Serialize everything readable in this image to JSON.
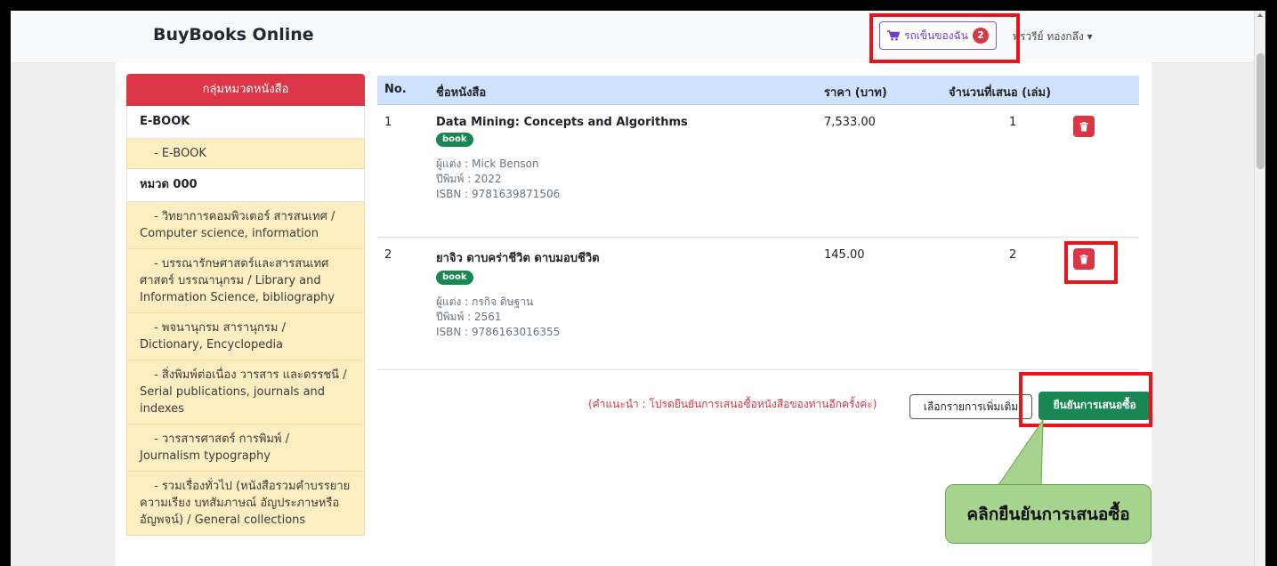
{
  "navbar": {
    "brand": "BuyBooks Online",
    "cart_label": "รถเข็นของฉัน",
    "cart_count": "2",
    "user_name": "พรวรีย์ ทองกลึง"
  },
  "sidebar": {
    "header": "กลุ่มหมวดหนังสือ",
    "group_ebook": "E-BOOK",
    "item_ebook": "- E-BOOK",
    "group_000": "หมวด 000",
    "items": [
      "- วิทยาการคอมพิวเตอร์ สารสนเทศ / Computer science, information",
      "- บรรณารักษศาสตร์และสารสนเทศศาสตร์ บรรณานุกรม / Library and Information Science, bibliography",
      "- พจนานุกรม สารานุกรม / Dictionary, Encyclopedia",
      "- สิ่งพิมพ์ต่อเนื่อง วารสาร และดรรชนี / Serial publications, journals and indexes",
      "- วารสารศาสตร์ การพิมพ์ / Journalism typography",
      "- รวมเรื่องทั่วไป (หนังสือรวมคำบรรยาย ความเรียง บทสัมภาษณ์ อัญประภาษหรืออัญพจน์) / General collections"
    ]
  },
  "table": {
    "headers": {
      "no": "No.",
      "title": "ชื่อหนังสือ",
      "price": "ราคา (บาท)",
      "qty": "จำนวนที่เสนอ (เล่ม)"
    },
    "rows": [
      {
        "no": "1",
        "title": "Data Mining: Concepts and Algorithms",
        "badge": "book",
        "author": "ผู้แต่ง : Mick Benson",
        "year": "ปีพิมพ์ : 2022",
        "isbn": "ISBN : 9781639871506",
        "price": "7,533.00",
        "qty": "1"
      },
      {
        "no": "2",
        "title": "ยาจิว ดาบคร่าชีวิต ดาบมอบชีวิต",
        "badge": "book",
        "author": "ผู้แต่ง : กรกิจ ดิษฐาน",
        "year": "ปีพิมพ์ : 2561",
        "isbn": "ISBN : 9786163016355",
        "price": "145.00",
        "qty": "2"
      }
    ]
  },
  "footer": {
    "hint": "(คำแนะนำ : โปรดยืนยันการเสนอซื้อหนังสือของท่านอีกครั้งค่ะ)",
    "more_button": "เลือกรายการเพิ่มเติม",
    "confirm_button": "ยืนยันการเสนอซื้อ"
  },
  "callout": {
    "text": "คลิกยืนยันการเสนอซื้อ"
  },
  "colors": {
    "accent_red": "#dc3545",
    "green": "#198754",
    "header_blue": "#cfe2ff",
    "annotation_red": "#e8131b"
  }
}
